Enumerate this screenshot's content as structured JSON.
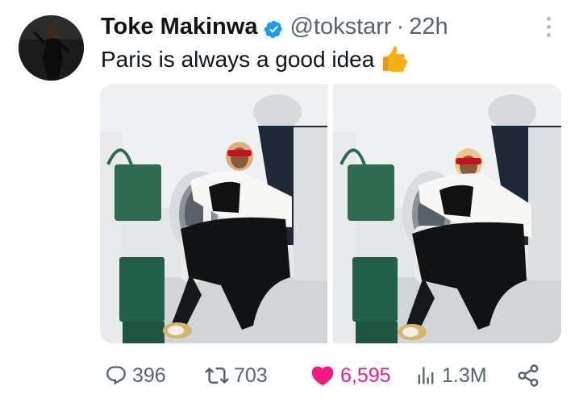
{
  "tweet": {
    "author_name": "Toke Makinwa",
    "handle": "@tokstarr",
    "separator": "·",
    "time": "22h",
    "text": "Paris is always a good idea",
    "emoji_icon": "thumbs-up-icon",
    "verified_icon": "verified-badge-icon",
    "verified_color": "#1d9bf0"
  },
  "media": [
    {
      "kind": "photo",
      "index": 1
    },
    {
      "kind": "photo",
      "index": 2
    }
  ],
  "actions": {
    "replies": "396",
    "reposts": "703",
    "likes": "6,595",
    "views": "1.3M",
    "liked": true,
    "like_color": "#f91880",
    "icon_color": "#536471",
    "icons": [
      "reply-icon",
      "repost-icon",
      "heart-icon",
      "views-icon",
      "share-icon"
    ]
  }
}
